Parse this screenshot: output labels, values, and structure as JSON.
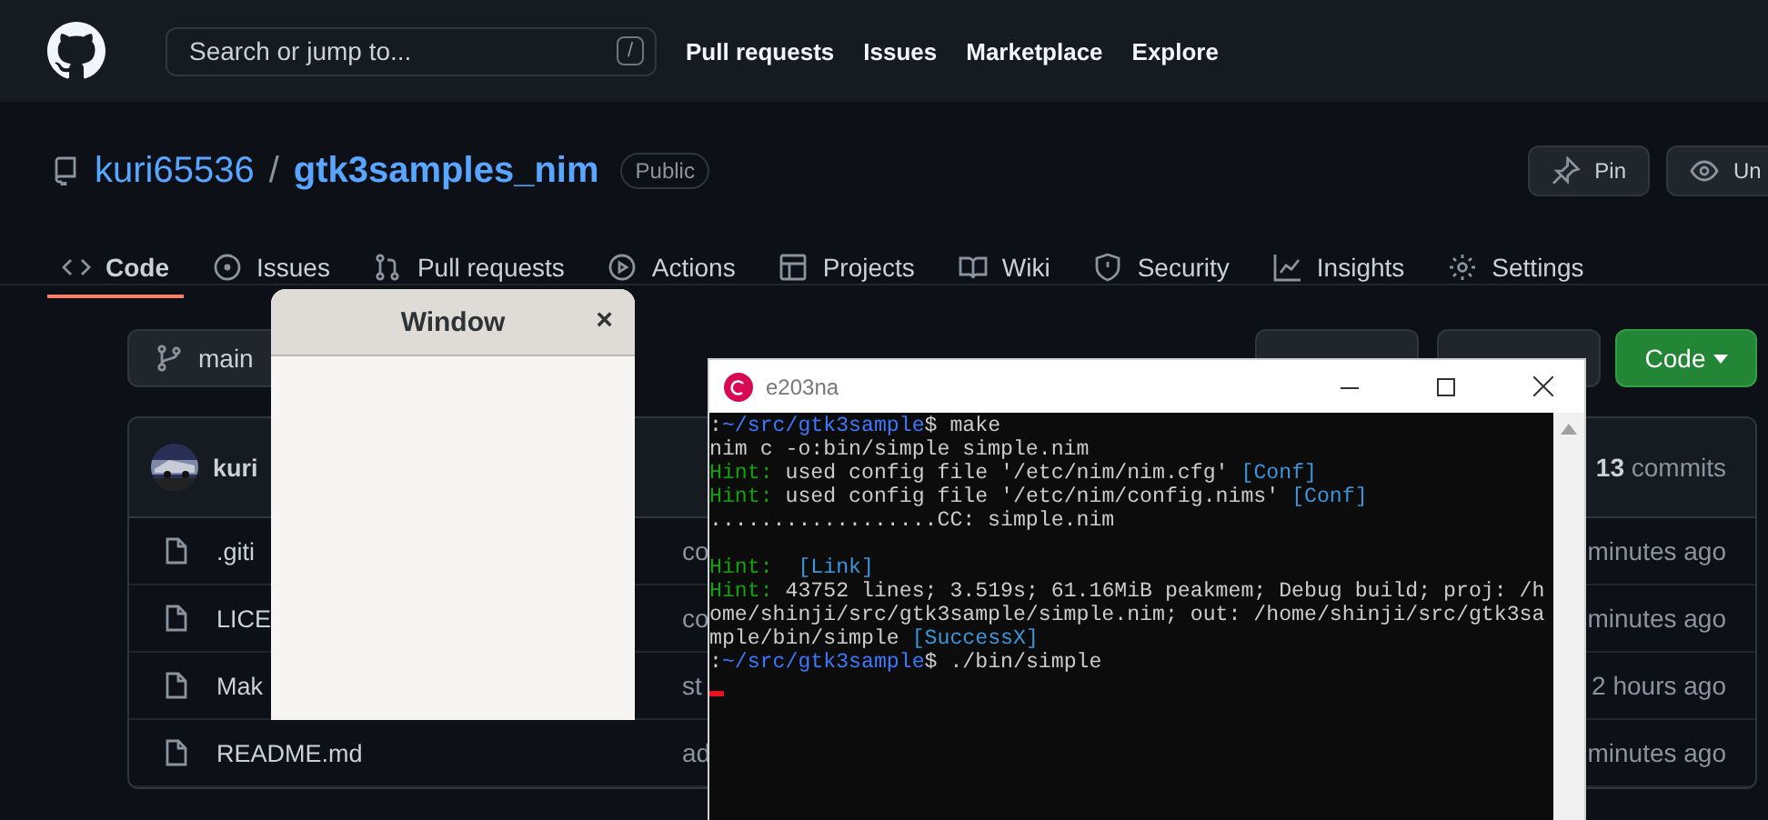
{
  "header": {
    "search_placeholder": "Search or jump to...",
    "search_key": "/",
    "nav": [
      "Pull requests",
      "Issues",
      "Marketplace",
      "Explore"
    ]
  },
  "repo": {
    "owner": "kuri65536",
    "separator": "/",
    "name": "gtk3samples_nim",
    "visibility": "Public",
    "actions": [
      {
        "label": "Pin",
        "kind": "pin"
      },
      {
        "label": "Un",
        "kind": "watch"
      }
    ]
  },
  "tabs": [
    {
      "label": "Code",
      "kind": "code",
      "selected": true
    },
    {
      "label": "Issues",
      "kind": "issues",
      "selected": false
    },
    {
      "label": "Pull requests",
      "kind": "pulls",
      "selected": false
    },
    {
      "label": "Actions",
      "kind": "actions",
      "selected": false
    },
    {
      "label": "Projects",
      "kind": "projects",
      "selected": false
    },
    {
      "label": "Wiki",
      "kind": "wiki",
      "selected": false
    },
    {
      "label": "Security",
      "kind": "security",
      "selected": false
    },
    {
      "label": "Insights",
      "kind": "insights",
      "selected": false
    },
    {
      "label": "Settings",
      "kind": "settings",
      "selected": false
    }
  ],
  "branch": "main",
  "code_button": "Code",
  "commit": {
    "author": "kuri",
    "commits": "**13** commits"
  },
  "files": [
    {
      "name": ".giti",
      "message": "co",
      "time": "minutes ago"
    },
    {
      "name": "LICE",
      "message": "co",
      "time": "minutes ago"
    },
    {
      "name": "Mak",
      "message": "st",
      "time": "2 hours ago"
    },
    {
      "name": "README.md",
      "message": "ad",
      "time": "minutes ago"
    }
  ],
  "gtk_window": {
    "title": "Window",
    "close": "×"
  },
  "terminal": {
    "title": "e203na",
    "lines": [
      {
        "kind": "text",
        "segments": [
          {
            "kind": "plain",
            "text": ":"
          },
          {
            "kind": "path",
            "text": "~/src/gtk3sample"
          },
          {
            "kind": "plain",
            "text": "$ make"
          }
        ]
      },
      {
        "kind": "text",
        "segments": [
          {
            "kind": "plain",
            "text": "nim c -o:bin/simple simple.nim"
          }
        ]
      },
      {
        "kind": "text",
        "segments": [
          {
            "kind": "hint",
            "text": "Hint:"
          },
          {
            "kind": "plain",
            "text": " used config file '/etc/nim/nim.cfg' "
          },
          {
            "kind": "tag",
            "text": "[Conf]"
          }
        ]
      },
      {
        "kind": "text",
        "segments": [
          {
            "kind": "hint",
            "text": "Hint:"
          },
          {
            "kind": "plain",
            "text": " used config file '/etc/nim/config.nims' "
          },
          {
            "kind": "tag",
            "text": "[Conf]"
          }
        ]
      },
      {
        "kind": "text",
        "segments": [
          {
            "kind": "plain",
            "text": "..................CC: simple.nim"
          }
        ]
      },
      {
        "kind": "blank"
      },
      {
        "kind": "text",
        "segments": [
          {
            "kind": "hint",
            "text": "Hint:  "
          },
          {
            "kind": "tag",
            "text": "[Link]"
          }
        ]
      },
      {
        "kind": "text",
        "segments": [
          {
            "kind": "hint",
            "text": "Hint:"
          },
          {
            "kind": "plain",
            "text": " 43752 lines; 3.519s; 61.16MiB peakmem; Debug build; proj: /h"
          }
        ]
      },
      {
        "kind": "text",
        "segments": [
          {
            "kind": "plain",
            "text": "ome/shinji/src/gtk3sample/simple.nim; out: /home/shinji/src/gtk3sa"
          }
        ]
      },
      {
        "kind": "text",
        "segments": [
          {
            "kind": "plain",
            "text": "mple/bin/simple "
          },
          {
            "kind": "tag",
            "text": "[SuccessX]"
          }
        ]
      },
      {
        "kind": "text",
        "segments": [
          {
            "kind": "plain",
            "text": ":"
          },
          {
            "kind": "path",
            "text": "~/src/gtk3sample"
          },
          {
            "kind": "plain",
            "text": "$ ./bin/simple"
          }
        ]
      }
    ]
  }
}
